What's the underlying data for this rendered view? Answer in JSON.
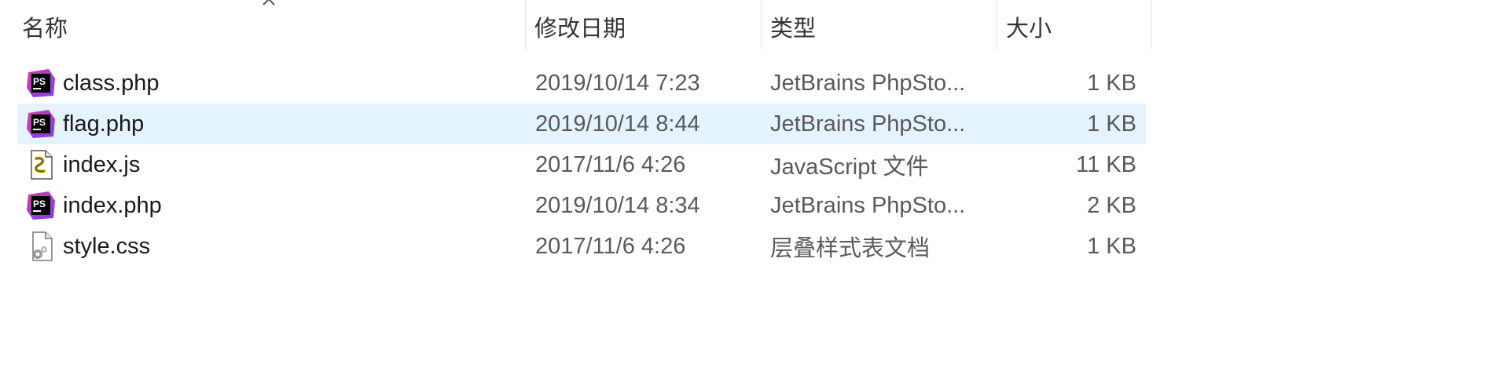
{
  "columns": {
    "name": "名称",
    "date": "修改日期",
    "type": "类型",
    "size": "大小"
  },
  "files": [
    {
      "name": "class.php",
      "date": "2019/10/14 7:23",
      "type": "JetBrains PhpSto...",
      "size": "1 KB",
      "icon": "phpstorm-icon",
      "selected": false
    },
    {
      "name": "flag.php",
      "date": "2019/10/14 8:44",
      "type": "JetBrains PhpSto...",
      "size": "1 KB",
      "icon": "phpstorm-icon",
      "selected": true
    },
    {
      "name": "index.js",
      "date": "2017/11/6 4:26",
      "type": "JavaScript 文件",
      "size": "11 KB",
      "icon": "javascript-file-icon",
      "selected": false
    },
    {
      "name": "index.php",
      "date": "2019/10/14 8:34",
      "type": "JetBrains PhpSto...",
      "size": "2 KB",
      "icon": "phpstorm-icon",
      "selected": false
    },
    {
      "name": "style.css",
      "date": "2017/11/6 4:26",
      "type": "层叠样式表文档",
      "size": "1 KB",
      "icon": "css-file-icon",
      "selected": false
    }
  ],
  "colors": {
    "selected_row": "#e5f3ff",
    "phpstorm_purple": "#8a3fd8",
    "phpstorm_pink": "#d83e9a"
  }
}
